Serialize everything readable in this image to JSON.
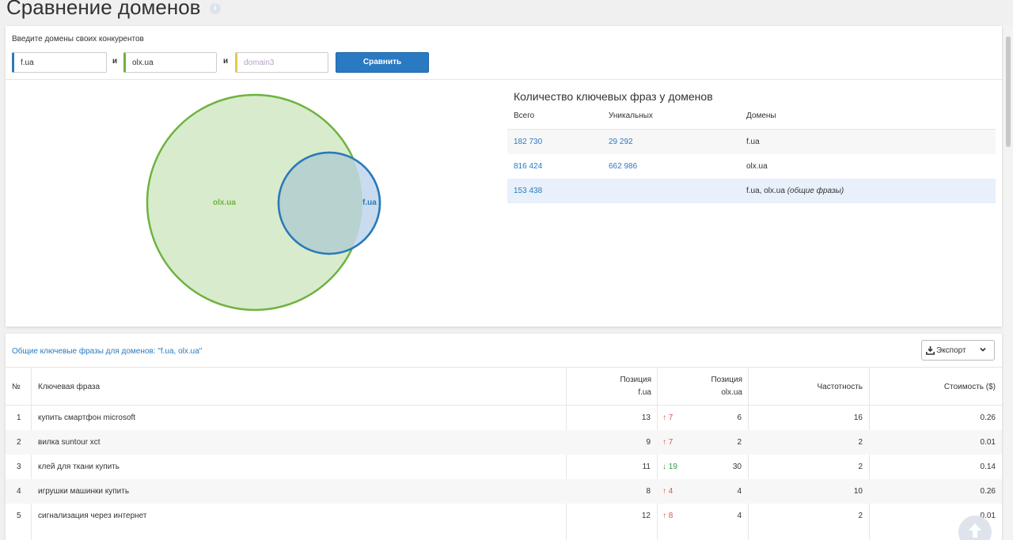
{
  "page": {
    "title": "Сравнение доменов",
    "info_icon": "info-icon"
  },
  "form": {
    "label": "Введите домены своих конкурентов",
    "domain1": {
      "value": "f.ua",
      "color": "#2a7ab8"
    },
    "and1": "и",
    "domain2": {
      "value": "olx.ua",
      "color": "#6db33f"
    },
    "and2": "и",
    "domain3": {
      "value": "",
      "placeholder": "domain3",
      "color": "#e6c84a"
    },
    "compare_label": "Сравнить"
  },
  "venn": {
    "big": {
      "label": "olx.ua",
      "color": "#6db33f",
      "fill": "#d9ebcd"
    },
    "small": {
      "label": "f.ua",
      "color": "#2a7ab8",
      "fill": "#c9dcef"
    }
  },
  "stats": {
    "title": "Количество ключевых фраз у доменов",
    "headers": {
      "total": "Всего",
      "unique": "Уникальных",
      "domains": "Домены"
    },
    "rows": [
      {
        "total": "182 730",
        "unique": "29 292",
        "domains": "f.ua",
        "note": ""
      },
      {
        "total": "816 424",
        "unique": "662 986",
        "domains": "olx.ua",
        "note": ""
      },
      {
        "total": "153 438",
        "unique": "",
        "domains": "f.ua, olx.ua",
        "note": "(общие фразы)"
      }
    ]
  },
  "keywords": {
    "title": "Общие ключевые фразы для доменов: \"f.ua, olx.ua\"",
    "export_label": "Экспорт",
    "headers": {
      "num": "№",
      "phrase": "Ключевая фраза",
      "pos1_a": "Позиция",
      "pos1_b": "f.ua",
      "pos2_a": "Позиция",
      "pos2_b": "olx.ua",
      "freq": "Частотность",
      "cost": "Стоимость ($)"
    },
    "rows": [
      {
        "num": "1",
        "phrase": "купить смартфон microsoft",
        "pos1": "13",
        "delta": "7",
        "dir": "up",
        "pos2": "6",
        "freq": "16",
        "cost": "0.26"
      },
      {
        "num": "2",
        "phrase": "вилка suntour xct",
        "pos1": "9",
        "delta": "7",
        "dir": "up",
        "pos2": "2",
        "freq": "2",
        "cost": "0.01"
      },
      {
        "num": "3",
        "phrase": "клей для ткани купить",
        "pos1": "11",
        "delta": "19",
        "dir": "down",
        "pos2": "30",
        "freq": "2",
        "cost": "0.14"
      },
      {
        "num": "4",
        "phrase": "игрушки машинки купить",
        "pos1": "8",
        "delta": "4",
        "dir": "up",
        "pos2": "4",
        "freq": "10",
        "cost": "0.26"
      },
      {
        "num": "5",
        "phrase": "сигнализация через интернет",
        "pos1": "12",
        "delta": "8",
        "dir": "up",
        "pos2": "4",
        "freq": "2",
        "cost": "0.01"
      }
    ]
  }
}
